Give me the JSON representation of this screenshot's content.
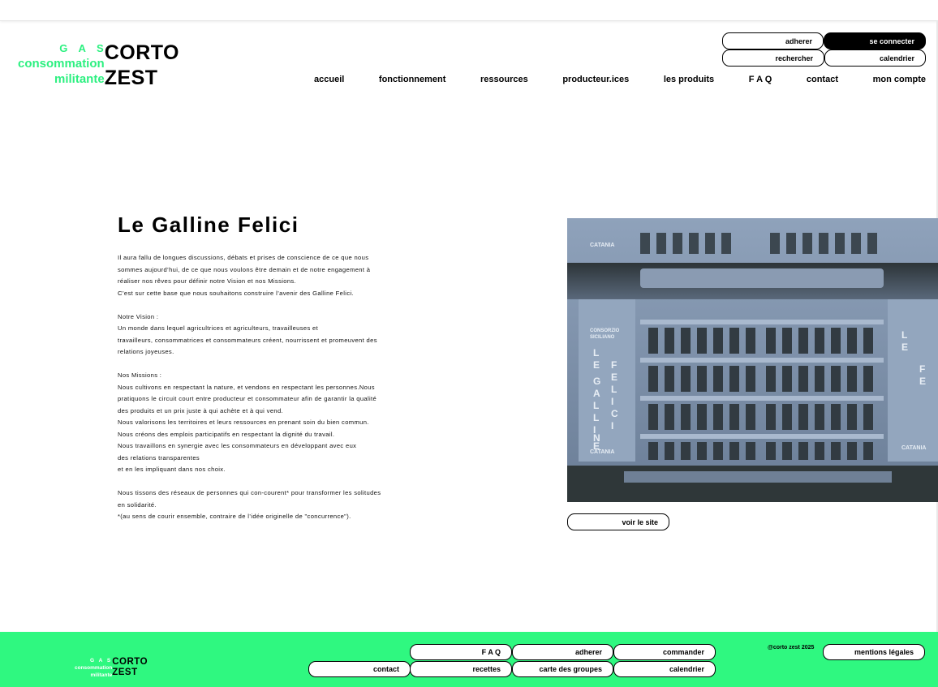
{
  "header": {
    "logo": {
      "left_lines": [
        "G A S",
        "consommation",
        "militante"
      ],
      "right_lines": [
        "CORTO",
        "ZEST"
      ]
    },
    "top_buttons": {
      "adherer": "adherer",
      "se_connecter": "se connecter",
      "rechercher": "rechercher",
      "calendrier": "calendrier"
    },
    "nav": [
      "accueil",
      "fonctionnement",
      "ressources",
      "producteur.ices",
      "les produits",
      "F A Q",
      "contact",
      "mon compte"
    ]
  },
  "main": {
    "title": "Le Galline Felici",
    "paragraphs": [
      "Il aura fallu de longues discussions, débats et prises de conscience de ce que nous",
      "sommes aujourd’hui, de ce que nous voulons être demain et de notre engagement à",
      "réaliser nos rêves pour définir notre Vision et nos Missions.",
      "C’est sur cette base que nous souhaitons construire l’avenir des Galline Felici.",
      "",
      "Notre Vision :",
      "Un monde dans lequel agricultrices et agriculteurs, travailleuses et",
      "travailleurs, consommatrices et consommateurs créent, nourrissent et promeuvent des",
      "relations joyeuses.",
      "",
      "Nos Missions :",
      "Nous cultivons en respectant la nature, et vendons en respectant les personnes.Nous",
      "pratiquons le circuit court entre producteur et consommateur afin de  garantir la qualité",
      "des produits et un prix juste à qui achète et à qui vend.",
      "Nous valorisons les territoires et leurs ressources en prenant soin du bien commun.",
      "Nous créons des emplois participatifs en respectant la  dignité du travail.",
      "Nous travaillons en synergie avec les consommateurs en développant avec eux",
      "des relations transparentes",
      "et en les impliquant dans nos choix.",
      "",
      "Nous tissons des réseaux de personnes qui con-courent* pour transformer les solitudes",
      "en solidarité.",
      "*(au sens de courir ensemble, contraire de l’idée originelle de \"concurrence\")."
    ],
    "photo": {
      "crate_text_left": [
        "CONSORZIO",
        "SICILIANO",
        "LE",
        "GALLINE",
        "FELICI",
        "CATANIA"
      ],
      "crate_text_top": "CATANIA"
    },
    "visit_button": "voir le site"
  },
  "footer": {
    "logo": {
      "left_lines": [
        "G A S",
        "consommation",
        "militante"
      ],
      "right_lines": [
        "CORTO",
        "ZEST"
      ]
    },
    "links": {
      "faq": "F A Q",
      "adherer": "adherer",
      "commander": "commander",
      "contact": "contact",
      "recettes": "recettes",
      "carte": "carte des groupes",
      "calendrier": "calendrier"
    },
    "copyright": "@corto zest 2025",
    "mentions": "mentions légales"
  },
  "colors": {
    "brand_green": "#2cf080",
    "footer_bg": "#2ff880",
    "crate_blue": "#7f93ad"
  }
}
